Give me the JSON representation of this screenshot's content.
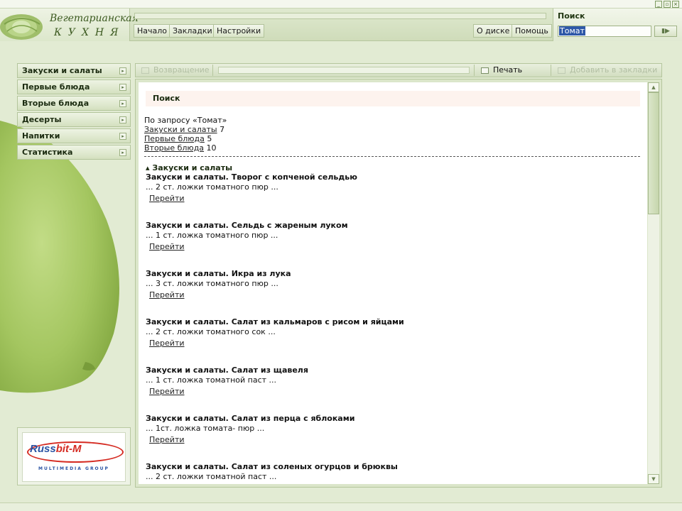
{
  "window": {
    "buttons": [
      "_",
      "▫",
      "×"
    ]
  },
  "logo": {
    "line1": "Вегетарианская",
    "line2": "КУХНЯ"
  },
  "nav": {
    "home": "Начало",
    "bookmarks": "Закладки",
    "settings": "Настройки",
    "about": "О диске",
    "help": "Помощь"
  },
  "search": {
    "title": "Поиск",
    "value": "Томат",
    "go_icon": "play-arrow-icon"
  },
  "sidebar": {
    "items": [
      {
        "label": "Закуски и салаты"
      },
      {
        "label": "Первые блюда"
      },
      {
        "label": "Вторые блюда"
      },
      {
        "label": "Десерты"
      },
      {
        "label": "Напитки"
      },
      {
        "label": "Статистика"
      }
    ]
  },
  "promo": {
    "brand_left": "Russ",
    "brand_right": "bit-M",
    "subtitle": "MULTIMEDIA GROUP"
  },
  "toolbar": {
    "back": "Возвращение",
    "print": "Печать",
    "add_bookmark": "Добавить в закладки"
  },
  "content": {
    "header": "Поиск",
    "query_text": "По запросу «Томат»",
    "summary": [
      {
        "label": "Закуски и салаты",
        "count": "7"
      },
      {
        "label": "Первые блюда",
        "count": "5"
      },
      {
        "label": "Вторые блюда",
        "count": "10"
      }
    ],
    "section_title": "Закуски и салаты",
    "go_label": "Перейти",
    "results": [
      {
        "title": "Закуски и салаты. Творог с копченой сельдью",
        "snippet": "... 2 ст. ложки томатного пюр ..."
      },
      {
        "title": "Закуски и салаты. Сельдь с жареным луком",
        "snippet": "... 1 ст. ложка томатного пюр ..."
      },
      {
        "title": "Закуски и салаты. Икра из лука",
        "snippet": "... 3 ст. ложки томатного пюр ..."
      },
      {
        "title": "Закуски и салаты. Салат из кальмаров с рисом и яйцами",
        "snippet": "... 2 ст. ложки томатного сок ..."
      },
      {
        "title": "Закуски и салаты. Салат из щавеля",
        "snippet": "... 1 ст. ложка томатной паст ..."
      },
      {
        "title": "Закуски и салаты. Салат из перца с яблоками",
        "snippet": "... 1ст. ложка томата- пюр ..."
      },
      {
        "title": "Закуски и салаты. Салат из соленых огурцов и брюквы",
        "snippet": "... 2 ст. ложки томатной паст ..."
      }
    ]
  },
  "colors": {
    "accent_green": "#3c5a20",
    "panel_green": "#d4e0bf",
    "fruit_green": "#9fc25c",
    "selection_blue": "#2f58a8"
  }
}
